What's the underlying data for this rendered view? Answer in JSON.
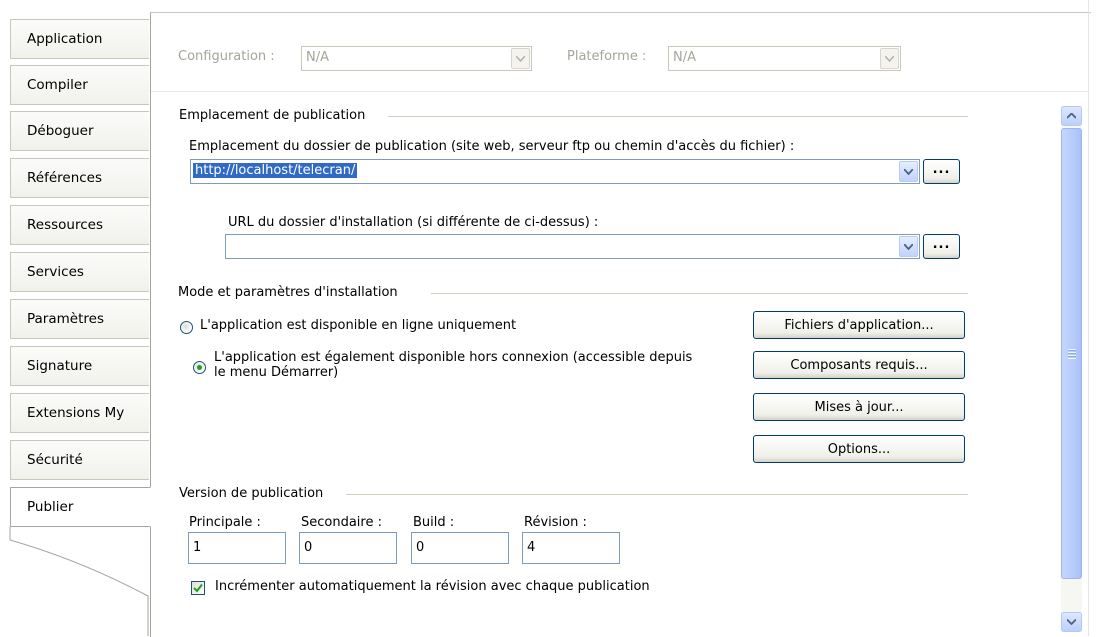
{
  "tabs": [
    {
      "label": "Application"
    },
    {
      "label": "Compiler"
    },
    {
      "label": "Déboguer"
    },
    {
      "label": "Références"
    },
    {
      "label": "Ressources"
    },
    {
      "label": "Services"
    },
    {
      "label": "Paramètres"
    },
    {
      "label": "Signature"
    },
    {
      "label": "Extensions My"
    },
    {
      "label": "Sécurité"
    },
    {
      "label": "Publier"
    }
  ],
  "active_tab": "Publier",
  "config_bar": {
    "configuration_label": "Configuration :",
    "configuration_value": "N/A",
    "platform_label": "Plateforme :",
    "platform_value": "N/A"
  },
  "publish_location": {
    "group_title": "Emplacement de publication",
    "folder_label": "Emplacement du dossier de publication (site web, serveur ftp ou chemin d'accès du fichier) :",
    "folder_value": "http://localhost/telecran/",
    "browse_label": "...",
    "install_url_label": "URL du dossier d'installation (si différente de ci-dessus) :",
    "install_url_value": "",
    "browse2_label": "..."
  },
  "install_mode": {
    "group_title": "Mode et paramètres d'installation",
    "online_only_label": "L'application est disponible en ligne uniquement",
    "offline_label_line1": "L'application est également disponible hors connexion (accessible depuis",
    "offline_label_line2": "le menu Démarrer)",
    "selected": "offline",
    "buttons": {
      "app_files": "Fichiers d'application...",
      "prerequisites": "Composants requis...",
      "updates": "Mises à jour...",
      "options": "Options..."
    }
  },
  "version": {
    "group_title": "Version de publication",
    "major_label": "Principale :",
    "major_value": "1",
    "minor_label": "Secondaire :",
    "minor_value": "0",
    "build_label": "Build :",
    "build_value": "0",
    "revision_label": "Révision :",
    "revision_value": "4",
    "auto_increment_label": "Incrémenter automatiquement la révision avec chaque publication",
    "auto_increment_checked": true
  },
  "colors": {
    "selection": "#316ac5",
    "radio_dot": "#21a121",
    "check_mark": "#21a121",
    "button_border": "#003c74",
    "scroll_thumb": "#b7cbfa"
  }
}
